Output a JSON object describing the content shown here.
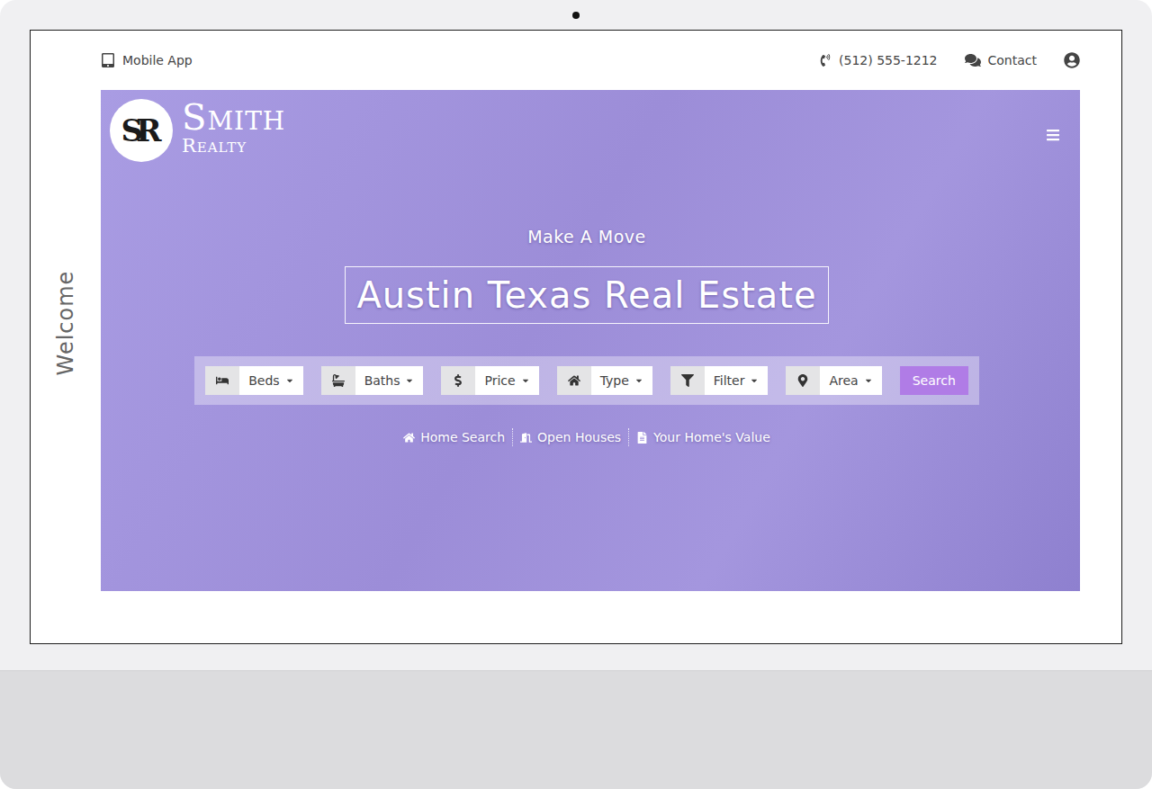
{
  "topbar": {
    "mobile_app": "Mobile App",
    "phone": "(512) 555-1212",
    "contact": "Contact"
  },
  "logo": {
    "initials": "SR",
    "name": "SMITH",
    "subtitle": "REALTY"
  },
  "side_label": "Welcome",
  "hero": {
    "kicker": "Make A Move",
    "title": "Austin Texas Real Estate"
  },
  "filters": [
    {
      "label": "Beds"
    },
    {
      "label": "Baths"
    },
    {
      "label": "Price"
    },
    {
      "label": "Type"
    },
    {
      "label": "Filter"
    },
    {
      "label": "Area"
    }
  ],
  "search_button": "Search",
  "links": [
    "Home Search",
    "Open Houses",
    "Your Home's Value"
  ]
}
